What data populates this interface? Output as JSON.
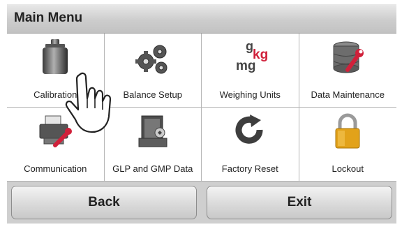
{
  "header": {
    "title": "Main Menu"
  },
  "menu": {
    "items": [
      {
        "label": "Calibration",
        "icon": "calibration-weight-icon"
      },
      {
        "label": "Balance Setup",
        "icon": "gears-icon"
      },
      {
        "label": "Weighing Units",
        "icon": "weighing-units-icon",
        "icon_text": {
          "g": "g",
          "kg": "kg",
          "mg": "mg"
        }
      },
      {
        "label": "Data Maintenance",
        "icon": "database-wrench-icon"
      },
      {
        "label": "Communication",
        "icon": "printer-cable-icon"
      },
      {
        "label": "GLP and GMP Data",
        "icon": "glp-document-icon"
      },
      {
        "label": "Factory Reset",
        "icon": "reset-arrow-icon"
      },
      {
        "label": "Lockout",
        "icon": "padlock-icon"
      }
    ]
  },
  "buttons": {
    "back": "Back",
    "exit": "Exit"
  },
  "colors": {
    "accent_red": "#d0203a",
    "lock_gold": "#e2a21a",
    "title_bar": "#d4d4d4"
  },
  "pointer": {
    "icon": "pointing-hand-icon"
  }
}
